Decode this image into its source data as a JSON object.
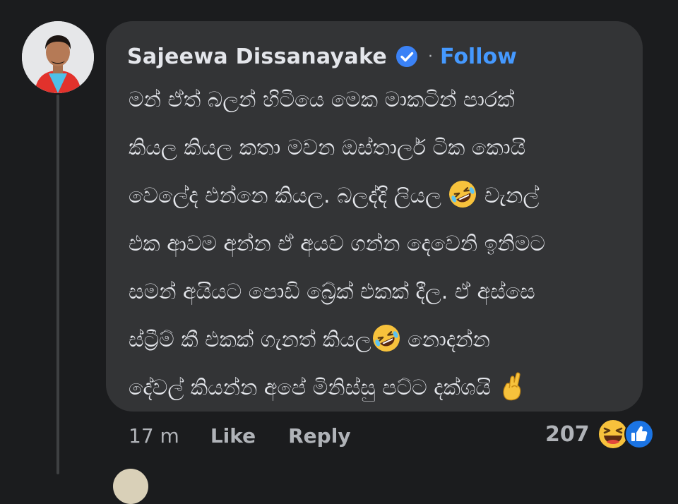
{
  "comment": {
    "author": "Sajeewa Dissanayake",
    "separator": "·",
    "follow_label": "Follow",
    "lines": [
      "මන් ඒත් බලන් හිටියෙ මෙක මාකටින් පාරක්",
      "කියල කියල කතා මවන ඔස්තාර්ල ටික කොයි",
      "වෙලේද එන්නෙ කියල. බලද්දි ලියල",
      "එක ආවම අන්න ඒ අයව ගන්න දෙවෙනි ඉනිමට",
      "සමන් අයියට පොඩි බ්‍රේක් එකක් දීල. ඒ අස්සෙ",
      "ස්ට්‍රීම් කී එකක් ගැනත් කියල",
      "දේවල් කියන්න අපේ මිනිස්සු පට්ට දක්ශයි"
    ],
    "line3_after_emoji": "චැනල්",
    "line6_after_emoji": "නොදන්න",
    "emojis": {
      "inline_1": "rolling-on-floor-laughing-emoji",
      "inline_2": "rolling-on-floor-laughing-emoji",
      "inline_3": "crossed-fingers-emoji"
    }
  },
  "actions": {
    "timestamp": "17 m",
    "like_label": "Like",
    "reply_label": "Reply"
  },
  "reactions": {
    "count": "207",
    "icons": [
      "laughing-emoji-icon",
      "like-thumb-icon"
    ]
  },
  "colors": {
    "background": "#1b1c1e",
    "bubble": "#333436",
    "text": "#e4e6eb",
    "secondary_text": "#b0b3b8",
    "link": "#4599ff",
    "verified": "#3b82f6"
  }
}
